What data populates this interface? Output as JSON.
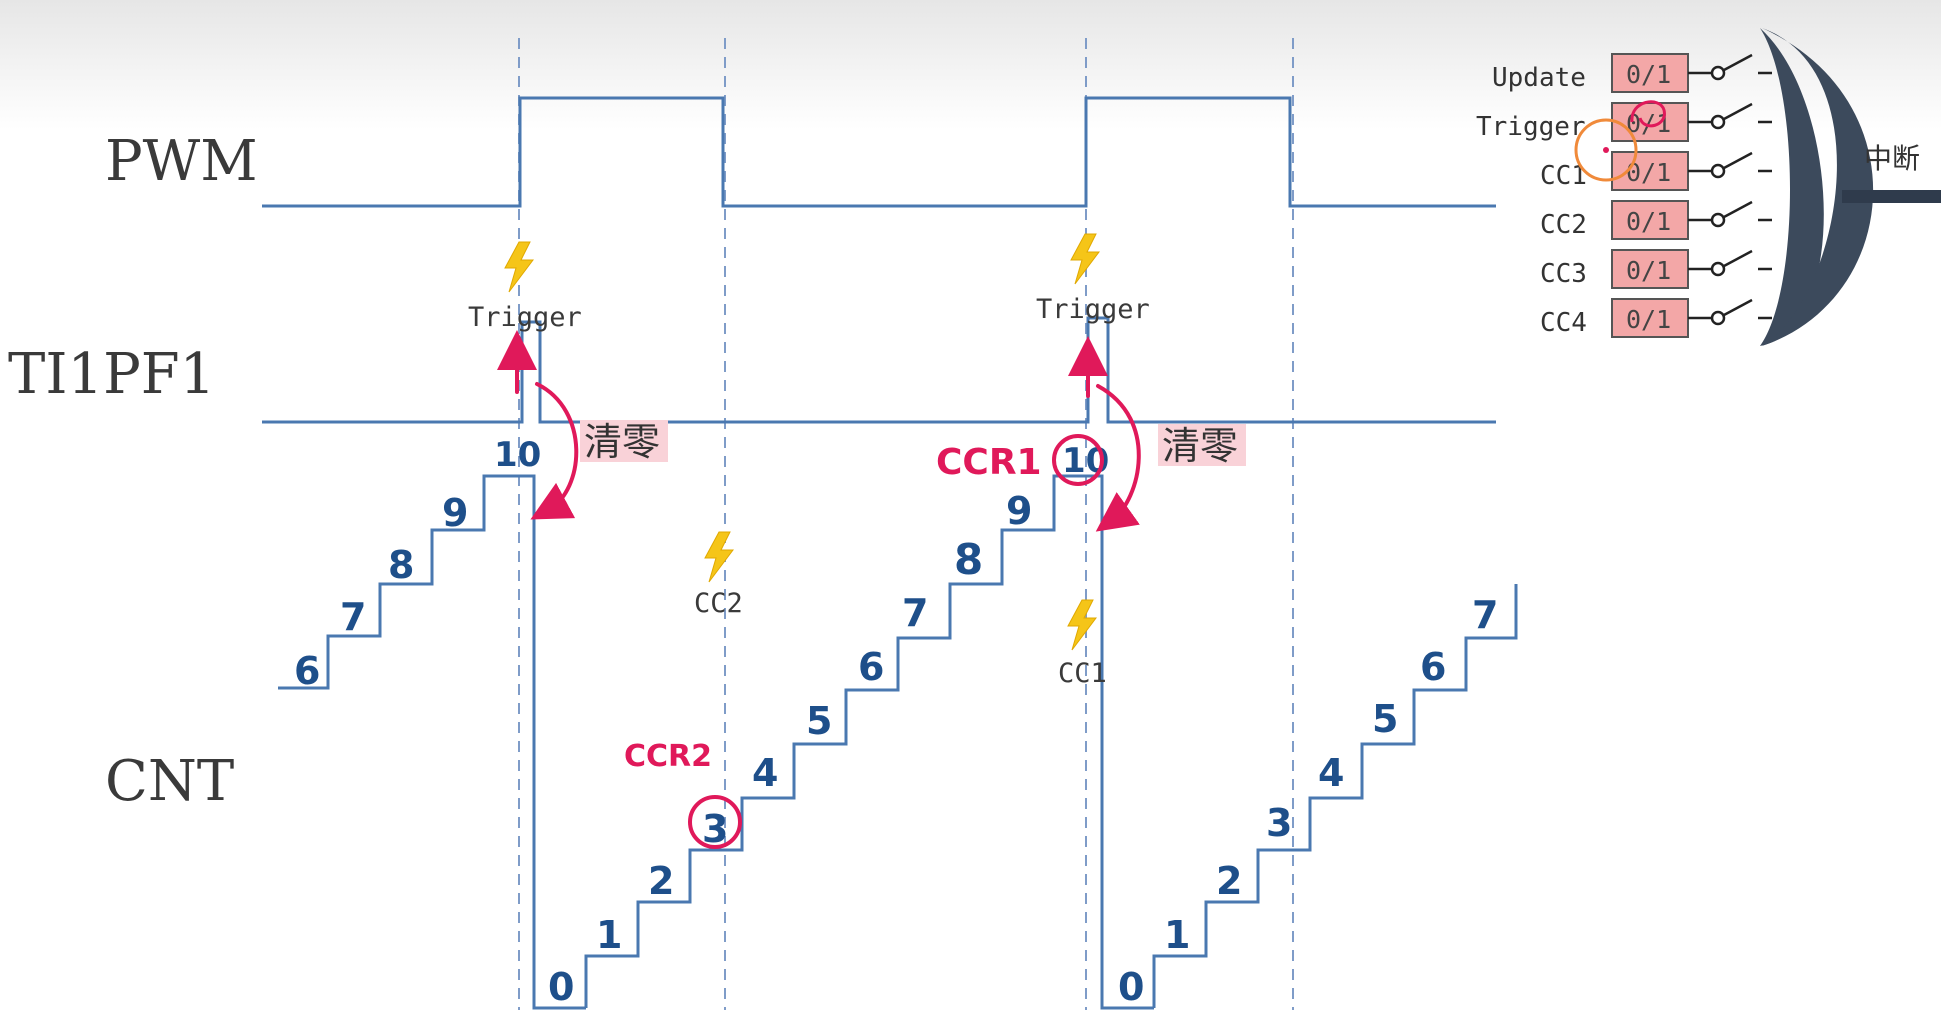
{
  "signals": {
    "pwm": "PWM",
    "ti1pf1": "TI1PF1",
    "cnt": "CNT"
  },
  "events": {
    "trigger_1": "Trigger",
    "trigger_2": "Trigger",
    "cc2": "CC2",
    "cc1": "CC1"
  },
  "annotations": {
    "clear_1": "清零",
    "clear_2": "清零",
    "ccr1": "CCR1",
    "ccr2": "CCR2"
  },
  "cnt_segment_1": [
    "6",
    "7",
    "8",
    "9",
    "10"
  ],
  "cnt_segment_2": [
    "0",
    "1",
    "2",
    "3",
    "4",
    "5",
    "6",
    "7",
    "8",
    "9",
    "10"
  ],
  "cnt_segment_3": [
    "0",
    "1",
    "2",
    "3",
    "4",
    "5",
    "6",
    "7"
  ],
  "interrupt_panel": {
    "sources": [
      "Update",
      "Trigger",
      "CC1",
      "CC2",
      "CC3",
      "CC4"
    ],
    "flag": "0/1",
    "output": "中断"
  },
  "colors": {
    "waveform": "#4a78b0",
    "dashed": "#7f9cc8",
    "digits": "#1e4f8a",
    "handwriting": "#e0195a",
    "flag_fill": "#f3a7a7",
    "gate": "#3c4a5c",
    "lightning": "#f5c518",
    "highlight": "#f9d2d8"
  }
}
